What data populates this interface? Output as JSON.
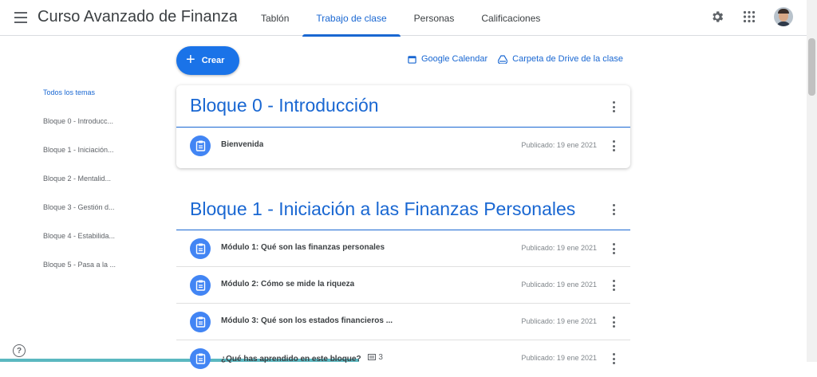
{
  "header": {
    "title": "Curso Avanzado de Finanzas Pe...",
    "tabs": [
      {
        "label": "Tablón"
      },
      {
        "label": "Trabajo de clase"
      },
      {
        "label": "Personas"
      },
      {
        "label": "Calificaciones"
      }
    ],
    "active_tab": "Trabajo de clase",
    "icons": [
      "menu-icon",
      "settings-icon",
      "apps-grid-icon",
      "avatar"
    ]
  },
  "toolbar": {
    "create_label": "Crear",
    "calendar_label": "Google Calendar",
    "drive_label": "Carpeta de Drive de la clase"
  },
  "sidebar": {
    "items": [
      {
        "label": "Todos los temas"
      },
      {
        "label": "Bloque 0 - Introducc..."
      },
      {
        "label": "Bloque 1 - Iniciación..."
      },
      {
        "label": "Bloque 2 - Mentalid..."
      },
      {
        "label": "Bloque 3 - Gestión d..."
      },
      {
        "label": "Bloque 4 - Estabilida..."
      },
      {
        "label": "Bloque 5 - Pasa a la ..."
      }
    ]
  },
  "topics": [
    {
      "title": "Bloque 0 - Introducción",
      "items": [
        {
          "title": "Bienvenida",
          "date": "Publicado: 19 ene 2021"
        }
      ]
    },
    {
      "title": "Bloque 1 - Iniciación a las Finanzas Personales",
      "items": [
        {
          "title": "Módulo 1: Qué son las finanzas personales",
          "date": "Publicado: 19 ene 2021"
        },
        {
          "title": "Módulo 2: Cómo se mide la riqueza",
          "date": "Publicado: 19 ene 2021"
        },
        {
          "title": "Módulo 3: Qué son los estados financieros ...",
          "date": "Publicado: 19 ene 2021"
        },
        {
          "title": "¿Qué has aprendido en este bloque?",
          "comments": "3",
          "date": "Publicado: 19 ene 2021"
        }
      ]
    }
  ],
  "colors": {
    "accent": "#1967d2",
    "button": "#1a73e8",
    "item_icon": "#4285f4"
  }
}
